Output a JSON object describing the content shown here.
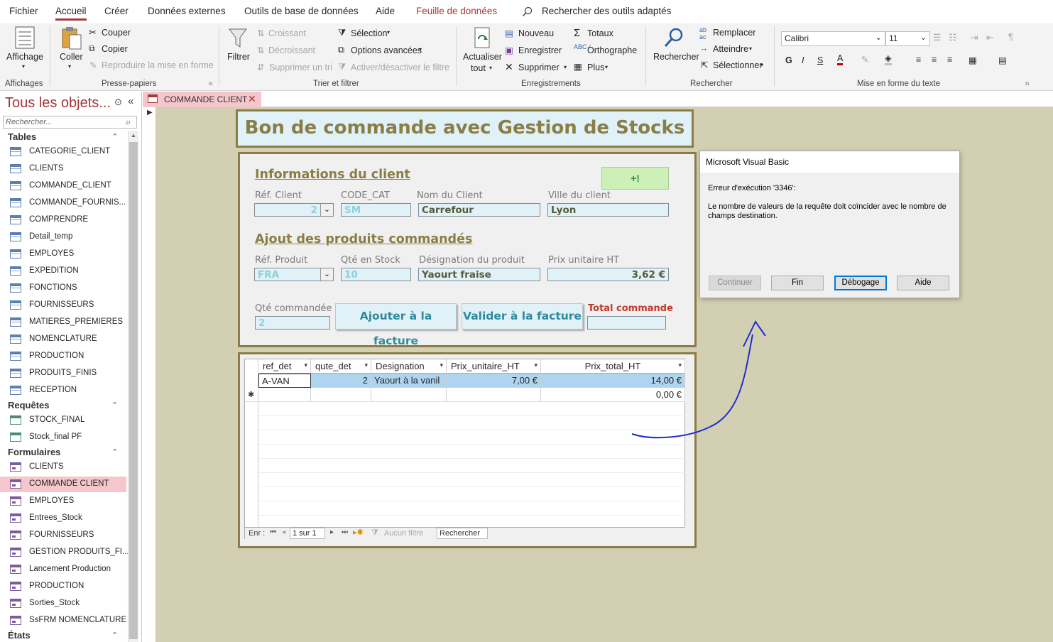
{
  "menu": {
    "items": [
      "Fichier",
      "Accueil",
      "Créer",
      "Données externes",
      "Outils de base de données",
      "Aide",
      "Feuille de données"
    ],
    "search_label": "Rechercher des outils adaptés"
  },
  "ribbon": {
    "affichages": {
      "affichage": "Affichage",
      "group": "Affichages"
    },
    "presse": {
      "coller": "Coller",
      "couper": "Couper",
      "copier": "Copier",
      "reproduire": "Reproduire la mise en forme",
      "group": "Presse-papiers"
    },
    "trier": {
      "filtrer": "Filtrer",
      "croissant": "Croissant",
      "decroissant": "Décroissant",
      "supprimer_tri": "Supprimer un tri",
      "selection": "Sélection",
      "options": "Options avancées",
      "activer": "Activer/désactiver le filtre",
      "group": "Trier et filtrer"
    },
    "enreg": {
      "actualiser": "Actualiser",
      "tout": "tout",
      "nouveau": "Nouveau",
      "enregistrer": "Enregistrer",
      "supprimer": "Supprimer",
      "totaux": "Totaux",
      "orthographe": "Orthographe",
      "plus": "Plus",
      "group": "Enregistrements"
    },
    "rechercher": {
      "rechercher": "Rechercher",
      "remplacer": "Remplacer",
      "atteindre": "Atteindre",
      "selectionner": "Sélectionner",
      "group": "Rechercher"
    },
    "mef": {
      "font": "Calibri",
      "size": "11",
      "bold": "G",
      "italic": "I",
      "underline": "S",
      "group": "Mise en forme du texte"
    }
  },
  "nav": {
    "title": "Tous les objets...",
    "search_placeholder": "Rechercher...",
    "sections": {
      "tables": "Tables",
      "requetes": "Requêtes",
      "formulaires": "Formulaires",
      "etats": "États"
    },
    "tables": [
      "CATEGORIE_CLIENT",
      "CLIENTS",
      "COMMANDE_CLIENT",
      "COMMANDE_FOURNIS...",
      "COMPRENDRE",
      "Detail_temp",
      "EMPLOYES",
      "EXPEDITION",
      "FONCTIONS",
      "FOURNISSEURS",
      "MATIERES_PREMIERES",
      "NOMENCLATURE",
      "PRODUCTION",
      "PRODUITS_FINIS",
      "RECEPTION"
    ],
    "requetes": [
      "STOCK_FINAL",
      "Stock_final PF"
    ],
    "formulaires": [
      "CLIENTS",
      "COMMANDE CLIENT",
      "EMPLOYES",
      "Entrees_Stock",
      "FOURNISSEURS",
      "GESTION PRODUITS_FI...",
      "Lancement Production",
      "PRODUCTION",
      "Sorties_Stock",
      "SsFRM NOMENCLATURE"
    ]
  },
  "tab": {
    "label": "COMMANDE CLIENT"
  },
  "form": {
    "title": "Bon de commande avec Gestion de Stocks",
    "client_heading": "Informations du client",
    "plus_button": "+!",
    "labels": {
      "ref_client": "Réf. Client",
      "code_cat": "CODE_CAT",
      "nom_client": "Nom du Client",
      "ville": "Ville du client",
      "ref_produit": "Réf. Produit",
      "qte_stock": "Qté en Stock",
      "designation": "Désignation du produit",
      "prix": "Prix unitaire HT",
      "qte_cmd": "Qté commandée",
      "total": "Total commande"
    },
    "values": {
      "ref_client": "2",
      "code_cat": "SM",
      "nom_client": "Carrefour",
      "ville": "Lyon",
      "ref_produit": "FRA",
      "qte_stock": "10",
      "designation": "Yaourt fraise",
      "prix": "3,62 €",
      "qte_cmd": "2",
      "total": ""
    },
    "produits_heading": "Ajout des produits commandés",
    "ajouter_button": "Ajouter à la facture",
    "valider_button": "Valider à la facture"
  },
  "grid": {
    "columns": [
      "ref_det",
      "qute_det",
      "Designation",
      "Prix_unitaire_HT",
      "Prix_total_HT"
    ],
    "rows": [
      [
        "A-VAN",
        "2",
        "Yaourt à la vanil",
        "7,00 €",
        "14,00 €"
      ]
    ],
    "new_row_total": "0,00 €",
    "new_row_marker": "✱",
    "nav": {
      "enr": "Enr :",
      "position": "1 sur 1",
      "filtre": "Aucun filtre",
      "rechercher": "Rechercher"
    }
  },
  "dialog": {
    "title": "Microsoft Visual Basic",
    "error": "Erreur d'exécution '3346':",
    "message": "Le nombre de valeurs de la requête doit coïncider avec le nombre de champs destination.",
    "buttons": {
      "continuer": "Continuer",
      "fin": "Fin",
      "debogage": "Débogage",
      "aide": "Aide"
    }
  },
  "colors": {
    "accent": "#a4373a",
    "form_text": "#8a7d45",
    "teal": "#2e8a9c",
    "annotation": "#1f2fd0"
  }
}
